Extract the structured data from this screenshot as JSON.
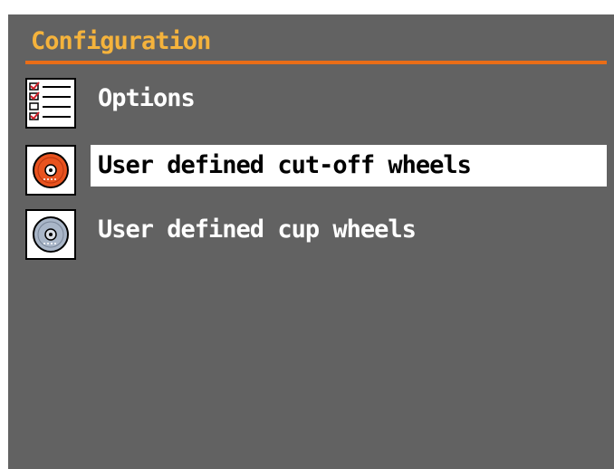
{
  "screen": {
    "title": "Configuration",
    "colors": {
      "background": "#626262",
      "title": "#f5b33c",
      "rule": "#ea6d17",
      "selection": "#ffffff"
    }
  },
  "menu": {
    "items": [
      {
        "label": "Options",
        "icon": "checklist-icon",
        "selected": false
      },
      {
        "label": "User defined cut-off wheels",
        "icon": "cut-off-wheel-icon",
        "selected": true
      },
      {
        "label": "User defined cup wheels",
        "icon": "cup-wheel-icon",
        "selected": false
      }
    ]
  }
}
